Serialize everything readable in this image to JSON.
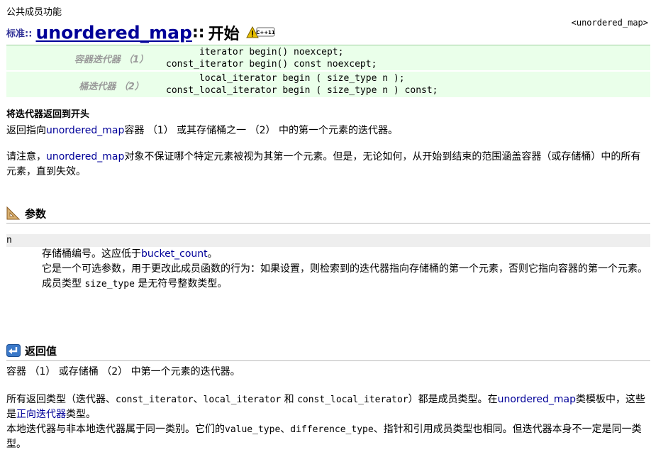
{
  "kicker": "公共成员功能",
  "header": {
    "ns": "标准::",
    "class_name": "unordered_map",
    "sep": "::",
    "func": "开始",
    "badge_text": "C++11",
    "ref": "<unordered_map>"
  },
  "declarations": [
    {
      "label": "容器迭代器 （1）",
      "lines": [
        "      iterator begin() noexcept;",
        "const_iterator begin() const noexcept;"
      ]
    },
    {
      "label": "桶迭代器 （2）",
      "lines": [
        "      local_iterator begin ( size_type n );",
        "const_local_iterator begin ( size_type n ) const;"
      ]
    }
  ],
  "description": {
    "title": "将迭代器返回到开头",
    "p1": {
      "pre": "返回指向",
      "link": "unordered_map",
      "post": "容器 （1） 或其存储桶之一 （2） 中的第一个元素的迭代器。"
    },
    "p2": {
      "pre": "请注意，",
      "link": "unordered_map",
      "post": "对象不保证哪个特定元素被视为其第一个元素。但是，无论如何，从开始到结束的范围涵盖容器（或存储桶）中的所有元素，直到失效。"
    }
  },
  "params": {
    "title": "参数",
    "name": "n",
    "line1_pre": "存储桶编号。这应低于",
    "line1_link": "bucket_count",
    "line1_post": "。",
    "line2": "它是一个可选参数，用于更改此成员函数的行为：如果设置，则检索到的迭代器指向存储桶的第一个元素，否则它指向容器的第一个元素。",
    "line3_pre": "成员类型 ",
    "line3_code": "size_type",
    "line3_post": " 是无符号整数类型。"
  },
  "returns": {
    "title": "返回值",
    "p1": "容器 （1） 或存储桶 （2） 中第一个元素的迭代器。",
    "p2_a": "所有返回类型（迭代器、",
    "p2_c1": "const_iterator",
    "p2_b": "、",
    "p2_c2": "local_iterator",
    "p2_c": " 和 ",
    "p2_c3": "const_local_iterator",
    "p2_d": "）都是成员类型。在",
    "p2_link1": "unordered_map",
    "p2_e": "类模板中，这些是",
    "p2_link2": "正向迭代器",
    "p2_f": "类型。",
    "p3_a": "本地迭代器与非本地迭代器属于同一类别。它们的",
    "p3_c1": "value_type",
    "p3_b": "、",
    "p3_c2": "difference_type",
    "p3_c": "、指针和引用成员类型也相同。但迭代器本身不一定是同一类型。"
  }
}
